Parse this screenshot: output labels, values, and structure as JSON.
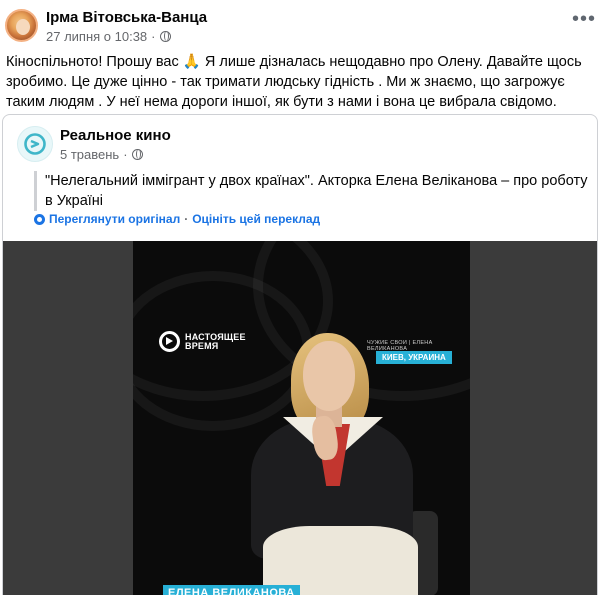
{
  "post": {
    "author": "Ірма Вітовська-Ванца",
    "date": "27 липня о 10:38",
    "more_label": "•••",
    "text": "Кіноспільното! Прошу вас 🙏 Я лише дізналась нещодавно про Олену. Давайте щось зробимо. Це дуже цінно - так тримати людську гідність . Ми ж знаємо, що загрожує таким людям . У неї нема дороги іншої, як бути з нами і вона це вибрала свідомо."
  },
  "shared": {
    "page_name": "Реальное кино",
    "date": "5 травень",
    "quote": "\"Нелегальний іммігрант у двох країнах\". Акторка Елена Веліканова – про роботу в Україні",
    "see_original": "Переглянути оригінал",
    "separator": "·",
    "rate_translation": "Оцініть цей переклад"
  },
  "video": {
    "brand_line1": "НАСТОЯЩЕЕ",
    "brand_line2": "ВРЕМЯ",
    "series": "ЧУЖИЕ СВОИ | ЕЛЕНА ВЕЛИКАНОВА",
    "location": "КИЕВ, УКРАИНА",
    "nameplate": "ЕЛЕНА ВЕЛИКАНОВА"
  },
  "colors": {
    "link": "#1b74e4",
    "secondary_text": "#65676b",
    "overlay_accent": "#27b0d6"
  }
}
